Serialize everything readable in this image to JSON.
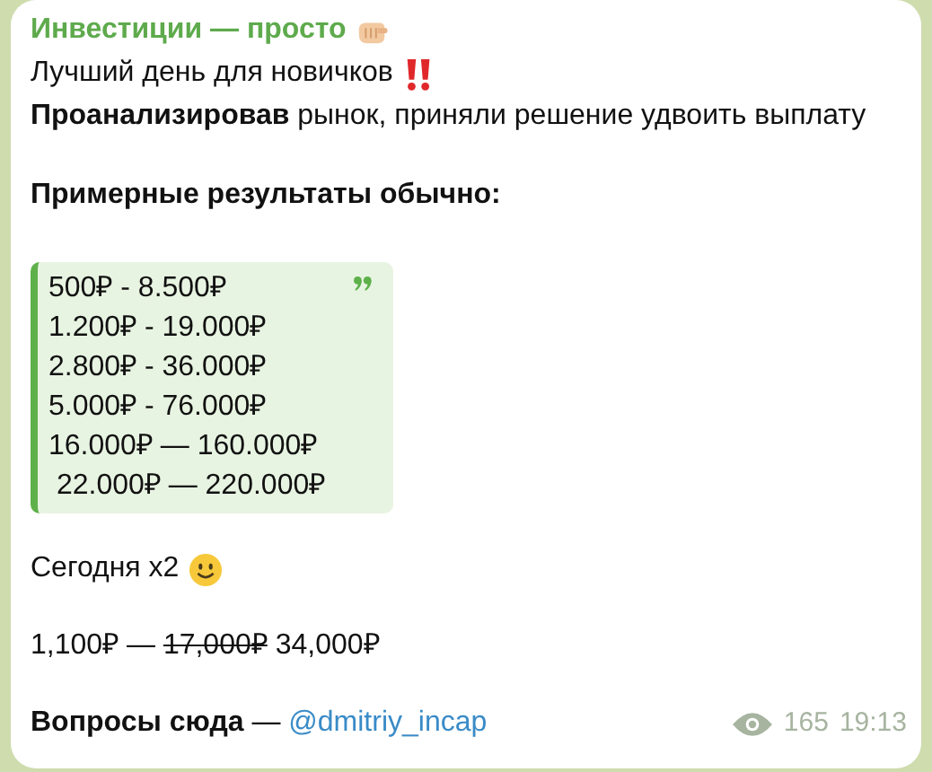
{
  "message": {
    "sender": "Инвестиции — просто",
    "lines": [
      "Лучший день для новичков",
      "**Проанализировав** рынок, приняли решение удвоить выплату"
    ],
    "heading": "Примерные результаты обычно:",
    "quote": [
      "500₽ - 8.500₽",
      "1.200₽ - 19.000₽",
      "2.800₽ - 36.000₽",
      "5.000₽ - 76.000₽",
      "16.000₽ — 160.000₽",
      " 22.000₽ — 220.000₽"
    ],
    "today": "Сегодня x2",
    "price": {
      "before": "1,100₽ — ",
      "struck": "17,000₽",
      "after": " 34,000₽"
    },
    "contact": {
      "text": "Вопросы сюда",
      "dash": " — ",
      "link": "@dmitriy_incap"
    },
    "views": "165",
    "time": "19:13"
  }
}
